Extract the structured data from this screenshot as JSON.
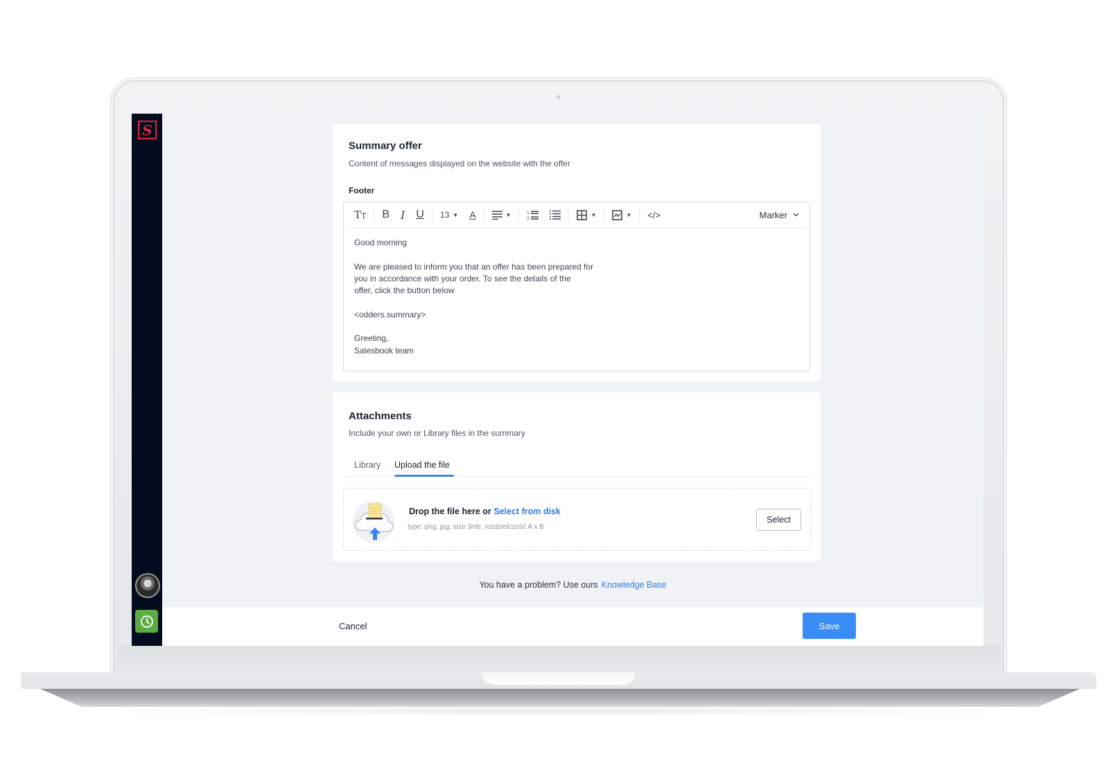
{
  "brand": {
    "logo_letter": "S",
    "logo_color": "#e0253a",
    "sidebar_color": "#030c1f"
  },
  "summary": {
    "title": "Summary offer",
    "subtitle": "Content of messages displayed on the website with the offer",
    "field_label": "Footer",
    "toolbar": {
      "items": [
        {
          "icon": "text-size-icon",
          "glyph": "Tт"
        },
        {
          "icon": "bold-icon",
          "glyph": "B"
        },
        {
          "icon": "italic-icon",
          "glyph": "I"
        },
        {
          "icon": "underline-icon",
          "glyph": "U"
        },
        {
          "icon": "font-size-dropdown",
          "glyph": "13"
        },
        {
          "icon": "text-color-icon",
          "glyph": "A"
        },
        {
          "icon": "align-icon",
          "glyph": "≡"
        },
        {
          "icon": "numbered-list-icon",
          "glyph": "⒈"
        },
        {
          "icon": "bullet-list-icon",
          "glyph": "☰"
        },
        {
          "icon": "table-icon",
          "glyph": "⊞"
        },
        {
          "icon": "image-icon",
          "glyph": "🖼"
        },
        {
          "icon": "code-icon",
          "glyph": "</>"
        }
      ],
      "font_size": "13",
      "marker_label": "Marker"
    },
    "body_lines": [
      "Good morning",
      "",
      "We are pleased to inform you that an offer has been prepared for",
      "you in accordance with your order. To see the details of the",
      "offer, click the button below",
      "",
      "<odders.summary>",
      "",
      "Greeting,",
      "Salesbook team"
    ]
  },
  "attachments": {
    "title": "Attachments",
    "subtitle": "Include your own or Library files in the summary",
    "tabs": [
      {
        "label": "Library",
        "active": false
      },
      {
        "label": "Upload the file",
        "active": true
      }
    ],
    "dropzone": {
      "title": "Drop the file here or",
      "link": "Select from disk",
      "hint": "type: png, jpg; size 3mb, rozdzielczość A x B",
      "button": "Select"
    }
  },
  "help": {
    "text": "You have a problem? Use ours",
    "link": "Knowledge Base"
  },
  "footer": {
    "cancel": "Cancel",
    "save": "Save",
    "save_color": "#3a8cf6"
  }
}
